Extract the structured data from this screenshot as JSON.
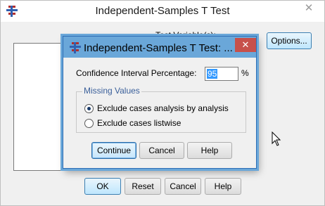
{
  "main_dialog": {
    "title": "Independent-Samples T Test",
    "close_glyph": "✕",
    "test_variables_label": "Test Variable(s):",
    "buttons": {
      "options": "Options...",
      "ok": "OK",
      "reset": "Reset",
      "cancel": "Cancel",
      "help": "Help"
    }
  },
  "options_dialog": {
    "title": "Independent-Samples T Test: ...",
    "close_glyph": "✕",
    "confidence_label": "Confidence Interval Percentage:",
    "confidence_value": "95",
    "percent_sign": "%",
    "missing_values": {
      "legend": "Missing Values",
      "options": [
        {
          "label": "Exclude cases analysis by analysis",
          "selected": true
        },
        {
          "label": "Exclude cases listwise",
          "selected": false
        }
      ]
    },
    "buttons": {
      "continue": "Continue",
      "cancel": "Cancel",
      "help": "Help"
    }
  },
  "colors": {
    "modal_titlebar": "#6aa7d9",
    "close_red": "#c7504b",
    "selection_blue": "#3399ff",
    "group_legend": "#3a5f9a"
  },
  "icons": [
    "spss-app-icon",
    "close-icon",
    "mouse-cursor-icon"
  ]
}
